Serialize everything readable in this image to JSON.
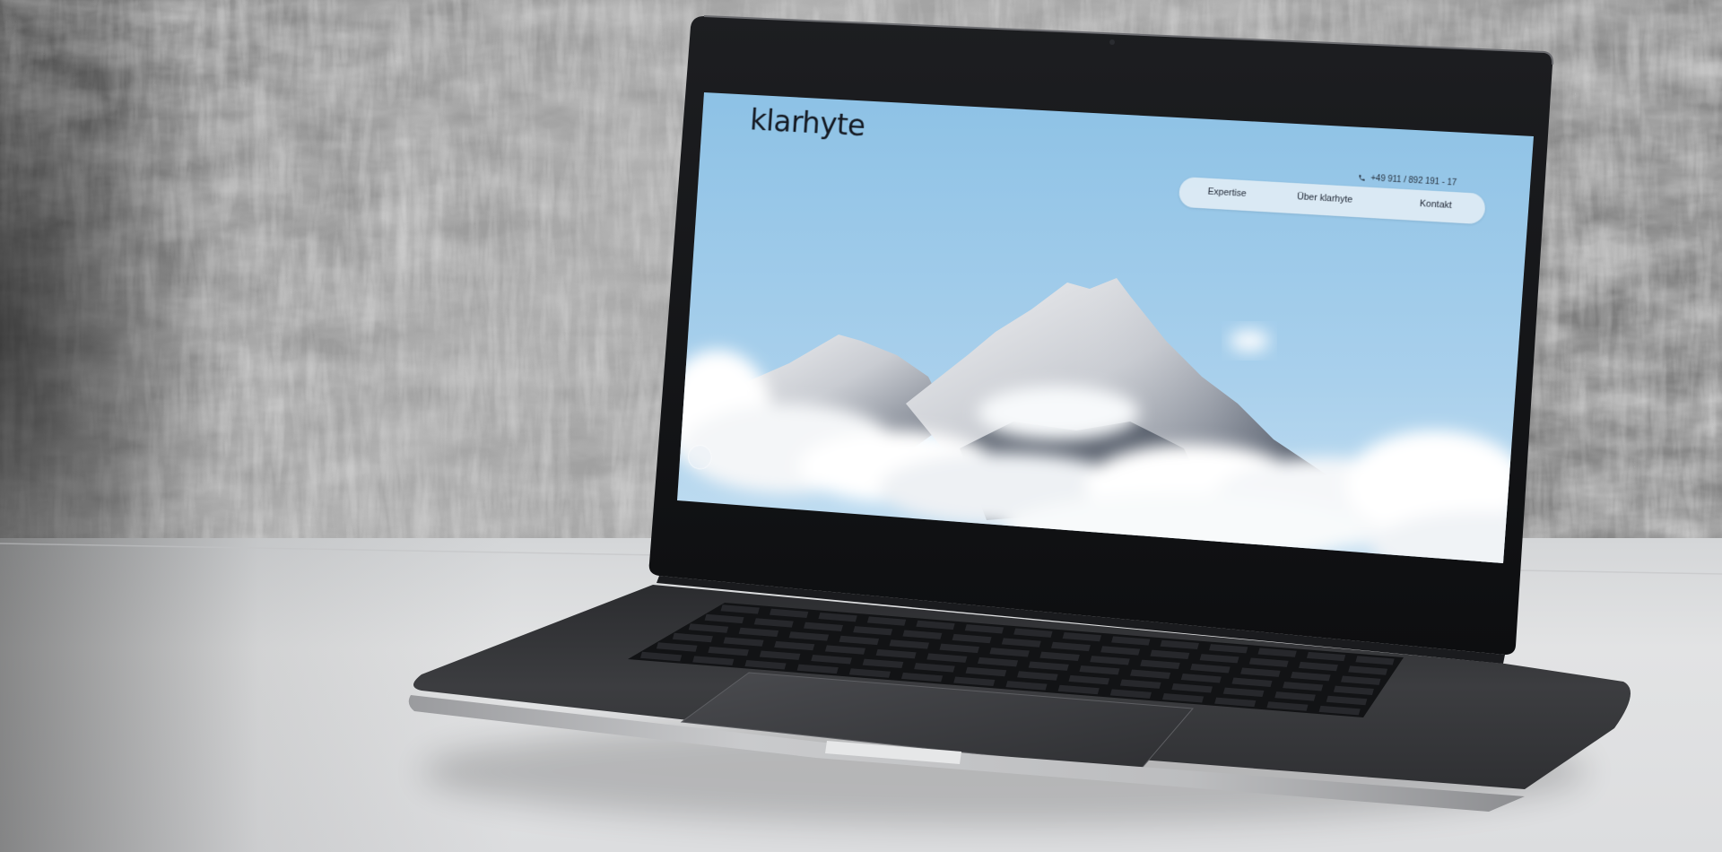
{
  "website": {
    "logo": "klarhyte",
    "phone": {
      "icon": "phone-icon",
      "number": "+49 911 / 892 191 - 17"
    },
    "nav": [
      {
        "label": "Expertise"
      },
      {
        "label": "Über klarhyte"
      },
      {
        "label": "Kontakt"
      }
    ],
    "scroll_indicator_icon": "circle-icon"
  },
  "colors": {
    "sky_top": "#8fc3e6",
    "sky_bottom": "#bfdcf0",
    "wall": "#8b8b8b",
    "desk": "#dedfe0",
    "laptop_body": "#3a3b3e"
  }
}
